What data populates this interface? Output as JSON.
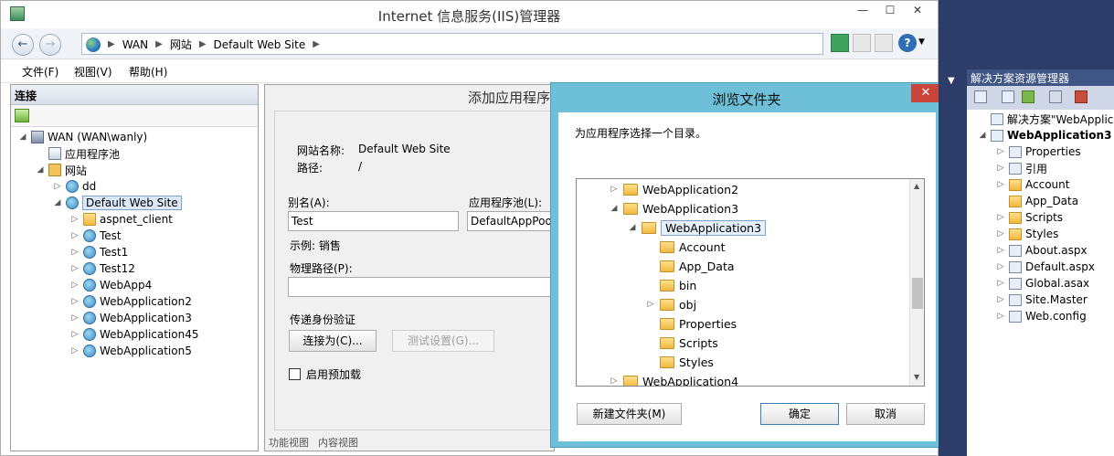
{
  "iis": {
    "title": "Internet 信息服务(IIS)管理器",
    "breadcrumb": [
      "WAN",
      "网站",
      "Default Web Site"
    ],
    "menu": [
      "文件(F)",
      "视图(V)",
      "帮助(H)"
    ]
  },
  "connections": {
    "header": "连接",
    "tree": [
      {
        "label": "WAN (WAN\\wanly)",
        "level": 0,
        "icon": "server-icon"
      },
      {
        "label": "应用程序池",
        "level": 1,
        "icon": "app-pool-icon"
      },
      {
        "label": "网站",
        "level": 1,
        "icon": "sites-icon"
      },
      {
        "label": "dd",
        "level": 2,
        "icon": "globe-icon"
      },
      {
        "label": "Default Web Site",
        "level": 2,
        "icon": "globe-icon"
      },
      {
        "label": "aspnet_client",
        "level": 3,
        "icon": "folder-icon"
      },
      {
        "label": "Test",
        "level": 3,
        "icon": "web-app-icon"
      },
      {
        "label": "Test1",
        "level": 3,
        "icon": "web-app-icon"
      },
      {
        "label": "Test12",
        "level": 3,
        "icon": "web-app-icon"
      },
      {
        "label": "WebApp4",
        "level": 3,
        "icon": "web-app-icon"
      },
      {
        "label": "WebApplication2",
        "level": 3,
        "icon": "web-app-icon"
      },
      {
        "label": "WebApplication3",
        "level": 3,
        "icon": "web-app-icon"
      },
      {
        "label": "WebApplication45",
        "level": 3,
        "icon": "web-app-icon"
      },
      {
        "label": "WebApplication5",
        "level": 3,
        "icon": "web-app-icon"
      }
    ]
  },
  "add_app": {
    "title": "添加应用程序",
    "site_name_label": "网站名称:",
    "site_name_value": "Default Web Site",
    "path_label": "路径:",
    "path_value": "/",
    "alias_label": "别名(A):",
    "alias_value": "Test",
    "pool_label": "应用程序池(L):",
    "pool_value": "DefaultAppPool",
    "example": "示例: 销售",
    "physical_path_label": "物理路径(P):",
    "physical_path_value": "",
    "pass_through_label": "传递身份验证",
    "connect_as": "连接为(C)...",
    "test_settings": "测试设置(G)...",
    "preload_label": "启用预加载",
    "bottom_tabs": [
      "功能视图",
      "内容视图"
    ]
  },
  "browse": {
    "title": "浏览文件夹",
    "prompt": "为应用程序选择一个目录。",
    "folders": [
      {
        "label": "WebApplication2",
        "level": 0,
        "expander": "▷"
      },
      {
        "label": "WebApplication3",
        "level": 0,
        "expander": "◢"
      },
      {
        "label": "WebApplication3",
        "level": 1,
        "expander": "◢",
        "selected": true
      },
      {
        "label": "Account",
        "level": 2,
        "expander": ""
      },
      {
        "label": "App_Data",
        "level": 2,
        "expander": ""
      },
      {
        "label": "bin",
        "level": 2,
        "expander": ""
      },
      {
        "label": "obj",
        "level": 2,
        "expander": "▷"
      },
      {
        "label": "Properties",
        "level": 2,
        "expander": ""
      },
      {
        "label": "Scripts",
        "level": 2,
        "expander": ""
      },
      {
        "label": "Styles",
        "level": 2,
        "expander": ""
      },
      {
        "label": "WebApplication4",
        "level": 0,
        "expander": "▷"
      }
    ],
    "new_folder": "新建文件夹(M)",
    "ok": "确定",
    "cancel": "取消",
    "close_glyph": "✕"
  },
  "solution_explorer": {
    "caption": "解决方案资源管理器",
    "items": [
      {
        "label": "解决方案\"WebApplicat",
        "level": 0,
        "expander": "",
        "folder": false
      },
      {
        "label": "WebApplication3",
        "level": 0,
        "expander": "◢",
        "folder": false,
        "bold": true
      },
      {
        "label": "Properties",
        "level": 1,
        "expander": "▷",
        "folder": false
      },
      {
        "label": "引用",
        "level": 1,
        "expander": "▷",
        "folder": false
      },
      {
        "label": "Account",
        "level": 1,
        "expander": "▷",
        "folder": true
      },
      {
        "label": "App_Data",
        "level": 1,
        "expander": "",
        "folder": true
      },
      {
        "label": "Scripts",
        "level": 1,
        "expander": "▷",
        "folder": true
      },
      {
        "label": "Styles",
        "level": 1,
        "expander": "▷",
        "folder": true
      },
      {
        "label": "About.aspx",
        "level": 1,
        "expander": "▷",
        "folder": false
      },
      {
        "label": "Default.aspx",
        "level": 1,
        "expander": "▷",
        "folder": false
      },
      {
        "label": "Global.asax",
        "level": 1,
        "expander": "▷",
        "folder": false
      },
      {
        "label": "Site.Master",
        "level": 1,
        "expander": "▷",
        "folder": false
      },
      {
        "label": "Web.config",
        "level": 1,
        "expander": "▷",
        "folder": false
      }
    ]
  }
}
